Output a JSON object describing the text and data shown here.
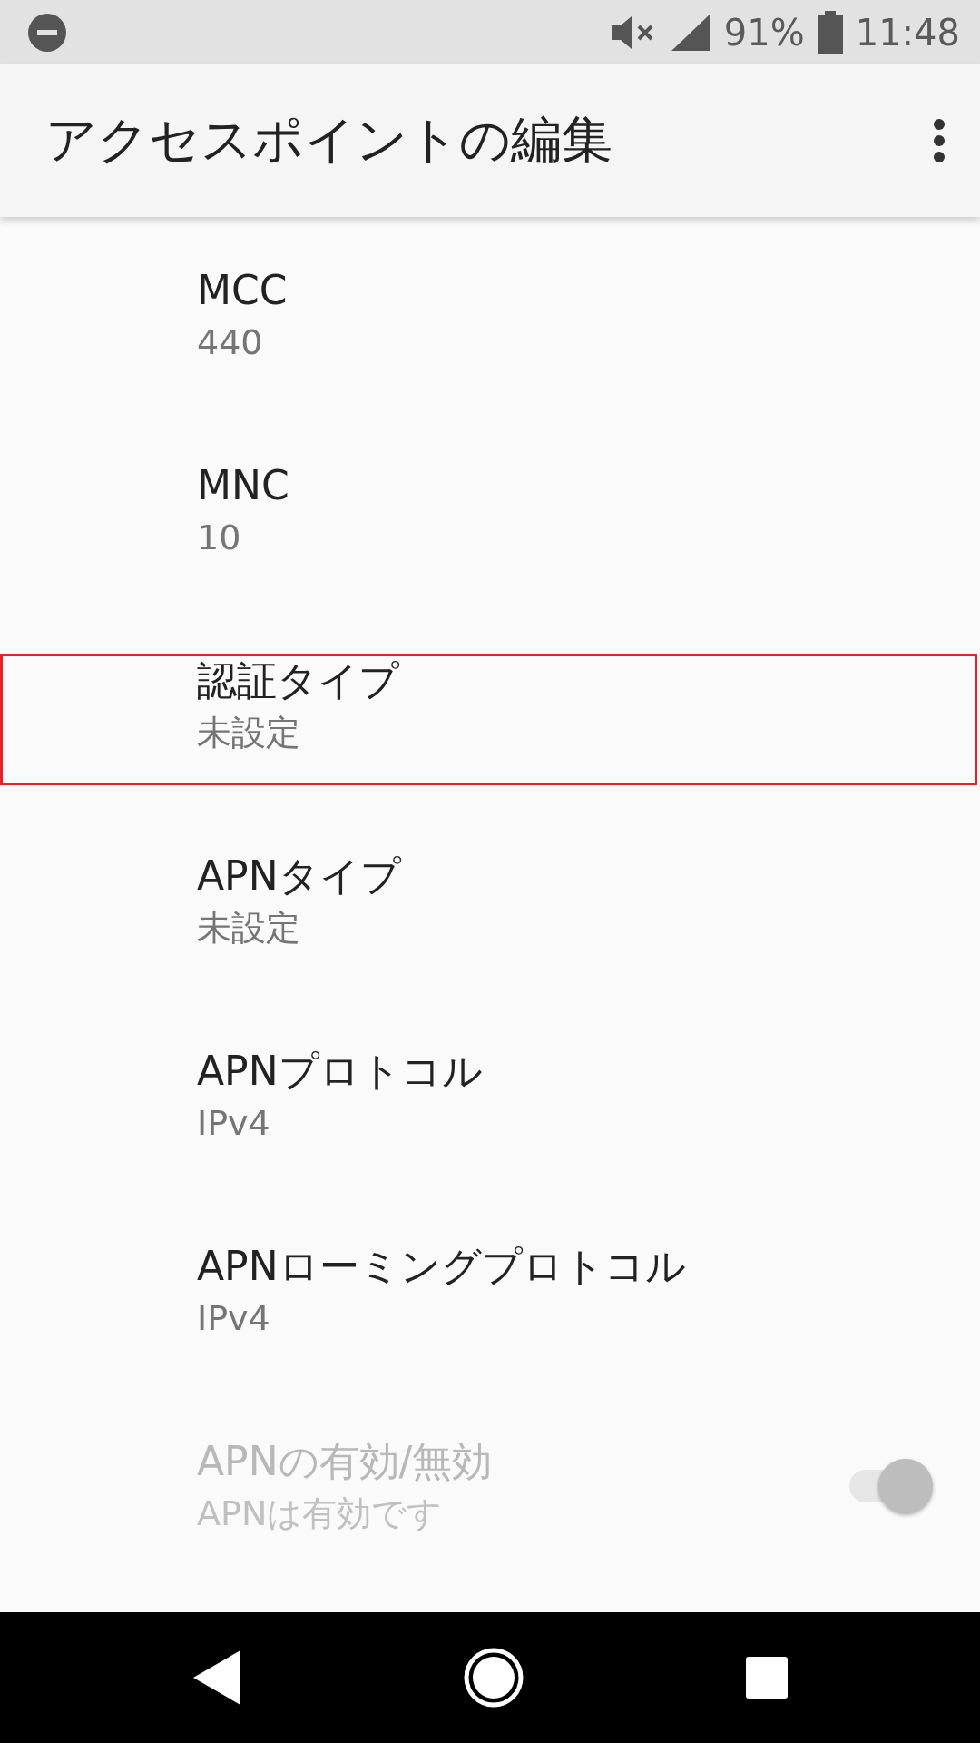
{
  "status_bar": {
    "battery": "91%",
    "time": "11:48"
  },
  "app_bar": {
    "title": "アクセスポイントの編集"
  },
  "settings": [
    {
      "kind": "text",
      "title": "MCC",
      "summary": "440",
      "highlighted": false,
      "disabled": false
    },
    {
      "kind": "text",
      "title": "MNC",
      "summary": "10",
      "highlighted": false,
      "disabled": false
    },
    {
      "kind": "text",
      "title": "認証タイプ",
      "summary": "未設定",
      "highlighted": true,
      "disabled": false
    },
    {
      "kind": "text",
      "title": "APNタイプ",
      "summary": "未設定",
      "highlighted": false,
      "disabled": false
    },
    {
      "kind": "text",
      "title": "APNプロトコル",
      "summary": "IPv4",
      "highlighted": false,
      "disabled": false
    },
    {
      "kind": "text",
      "title": "APNローミングプロトコル",
      "summary": "IPv4",
      "highlighted": false,
      "disabled": false
    },
    {
      "kind": "switch",
      "title": "APNの有効/無効",
      "summary": "APNは有効です",
      "highlighted": false,
      "disabled": true,
      "on": true
    }
  ]
}
